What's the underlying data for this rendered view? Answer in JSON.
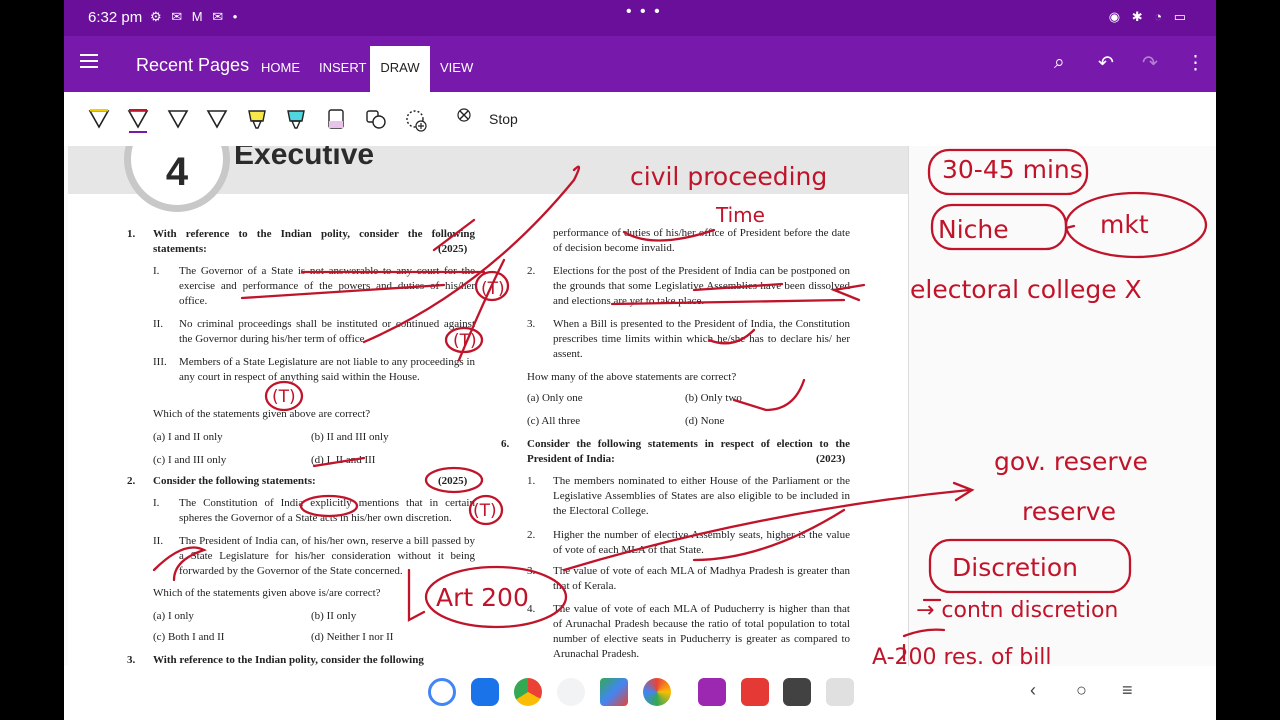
{
  "status_bar": {
    "time": "6:32 pm",
    "notif_icons": "⚙ ✉ M ✉ •",
    "dots": "• • •",
    "right_icons": "◉ ✱ ◔ ▭"
  },
  "app_bar": {
    "title": "Recent Pages",
    "tabs": [
      "HOME",
      "INSERT",
      "DRAW",
      "VIEW"
    ],
    "active_tab": "DRAW"
  },
  "ribbon": {
    "stop_label": "Stop"
  },
  "chapter": {
    "number": "4",
    "title": "Executive"
  },
  "left_column": {
    "q1": {
      "num": "1.",
      "stem": "With reference to the Indian polity, consider the following statements:",
      "year": "(2025)",
      "items": [
        {
          "roman": "I.",
          "text": "The Governor of a State is not answerable to any court for the exercise and performance of the powers and duties of his/her office."
        },
        {
          "roman": "II.",
          "text": "No criminal proceedings shall be instituted or continued against the Governor during his/her term of office."
        },
        {
          "roman": "III.",
          "text": "Members of a State Legislature are not liable to any proceedings in any court in respect of anything said within the House."
        }
      ],
      "ask": "Which of the statements given above are correct?",
      "options": [
        "(a)  I and II only",
        "(b)  II and III only",
        "(c)  I and III only",
        "(d)  I, II and III"
      ]
    },
    "q2": {
      "num": "2.",
      "stem": "Consider the following statements:",
      "year": "(2025)",
      "items": [
        {
          "roman": "I.",
          "text": "The Constitution of India explicitly mentions that in certain spheres the Governor of a State acts in his/her own discretion."
        },
        {
          "roman": "II.",
          "text": "The President of India can, of his/her own, reserve a bill passed by a State Legislature for his/her consideration without it being forwarded by the Governor of the State concerned."
        }
      ],
      "ask": "Which of the statements given above is/are correct?",
      "options": [
        "(a)  I only",
        "(b)  II only",
        "(c)  Both I and II",
        "(d)  Neither I nor II"
      ]
    },
    "q3": {
      "num": "3.",
      "stem": "With reference to the Indian polity, consider the following"
    }
  },
  "right_column": {
    "cont": "performance of duties of his/her office of President before the date of decision become invalid.",
    "items": [
      {
        "num": "2.",
        "text": "Elections for the post of the President of India can be postponed on the grounds that some Legislative Assemblies have been dissolved and elections are yet to take place."
      },
      {
        "num": "3.",
        "text": "When a Bill is presented to the President of India, the Constitution prescribes time limits within which he/she has to declare his/ her assent."
      }
    ],
    "ask": "How many of the above statements are correct?",
    "options": [
      "(a)  Only one",
      "(b)  Only two",
      "(c)  All three",
      "(d)  None"
    ],
    "q6": {
      "num": "6.",
      "stem": "Consider the following statements in respect of election to the President of India:",
      "year": "(2023)",
      "items": [
        {
          "num": "1.",
          "text": "The members nominated to either House of the Parliament or the Legislative Assemblies of States are also eligible to be included in the Electoral College."
        },
        {
          "num": "2.",
          "text": "Higher the number of elective Assembly seats, higher is the value of vote of each MLA of that State."
        },
        {
          "num": "3.",
          "text": "The value of vote of each MLA of Madhya Pradesh is greater than that of Kerala."
        },
        {
          "num": "4.",
          "text": "The value of vote of each MLA of Puducherry is higher than that of Arunachal Pradesh because the ratio of total population to total number of elective seats in Puducherry is greater as compared to Arunachal Pradesh."
        }
      ]
    }
  },
  "ink_notes": {
    "civil": "civil proceeding",
    "time": "Time",
    "mins": "30-45 mins",
    "niche": "Niche",
    "mkt": "mkt",
    "electoral": "electoral college X",
    "gov": "gov. reserve",
    "reserve": "reserve",
    "discretion": "Discretion",
    "contn": "→ contn discretion",
    "art": "Art 200",
    "a200": "A-200 res. of bill",
    "t_mark": "(T)"
  },
  "colors": {
    "brand": "#7719aa",
    "ink": "#c0142a"
  }
}
